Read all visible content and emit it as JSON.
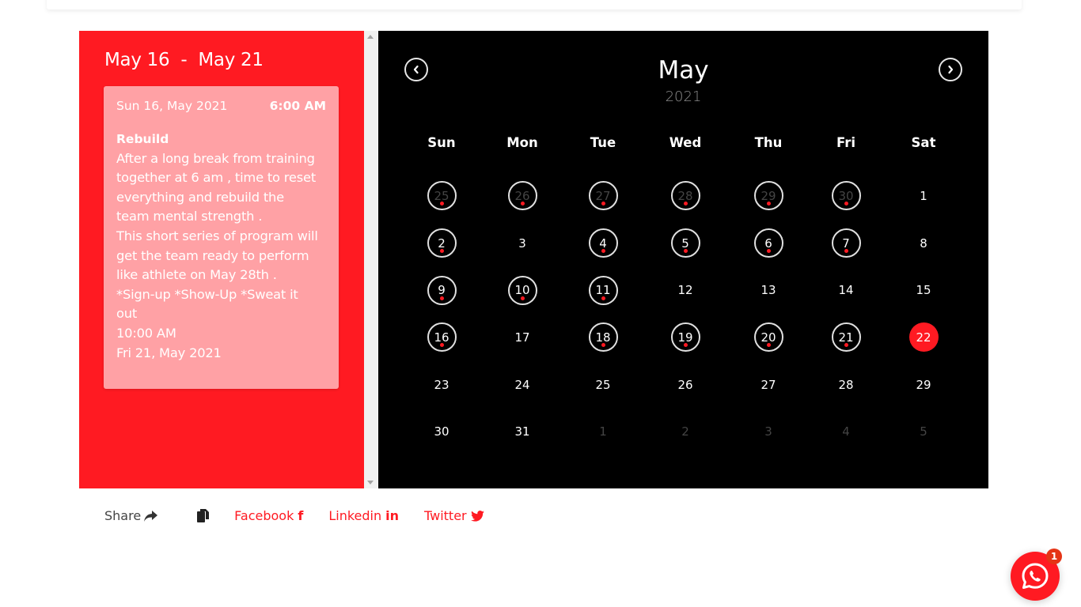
{
  "event_panel": {
    "range_title": "May 16  -  May 21",
    "event": {
      "start_date": "Sun 16, May 2021",
      "start_time": "6:00 AM",
      "title": "Rebuild",
      "description_lines": [
        "After a long break from training",
        "together at 6 am , time to reset",
        "everything and rebuild the",
        "team mental strength .",
        "This short series of program will",
        "get the team ready to perform",
        "like athlete on May 28th .",
        "*Sign-up *Show-Up *Sweat it",
        "out"
      ],
      "end_time": "10:00 AM",
      "end_date": "Fri 21, May 2021"
    }
  },
  "calendar": {
    "month": "May",
    "year": "2021",
    "prev_icon": "chevron-left-icon",
    "next_icon": "chevron-right-icon",
    "weekdays": [
      "Sun",
      "Mon",
      "Tue",
      "Wed",
      "Thu",
      "Fri",
      "Sat"
    ],
    "accent_color": "#ff1a22",
    "weeks": [
      [
        {
          "d": "25",
          "muted": true,
          "event": true
        },
        {
          "d": "26",
          "muted": true,
          "event": true
        },
        {
          "d": "27",
          "muted": true,
          "event": true
        },
        {
          "d": "28",
          "muted": true,
          "event": true
        },
        {
          "d": "29",
          "muted": true,
          "event": true
        },
        {
          "d": "30",
          "muted": true,
          "event": true
        },
        {
          "d": "1"
        }
      ],
      [
        {
          "d": "2",
          "event": true
        },
        {
          "d": "3"
        },
        {
          "d": "4",
          "event": true
        },
        {
          "d": "5",
          "event": true
        },
        {
          "d": "6",
          "event": true
        },
        {
          "d": "7",
          "event": true
        },
        {
          "d": "8"
        }
      ],
      [
        {
          "d": "9",
          "event": true
        },
        {
          "d": "10",
          "event": true
        },
        {
          "d": "11",
          "event": true
        },
        {
          "d": "12"
        },
        {
          "d": "13"
        },
        {
          "d": "14"
        },
        {
          "d": "15"
        }
      ],
      [
        {
          "d": "16",
          "event": true
        },
        {
          "d": "17"
        },
        {
          "d": "18",
          "event": true
        },
        {
          "d": "19",
          "event": true
        },
        {
          "d": "20",
          "event": true
        },
        {
          "d": "21",
          "event": true
        },
        {
          "d": "22",
          "today": true
        }
      ],
      [
        {
          "d": "23"
        },
        {
          "d": "24"
        },
        {
          "d": "25"
        },
        {
          "d": "26"
        },
        {
          "d": "27"
        },
        {
          "d": "28"
        },
        {
          "d": "29"
        }
      ],
      [
        {
          "d": "30"
        },
        {
          "d": "31"
        },
        {
          "d": "1",
          "muted": true
        },
        {
          "d": "2",
          "muted": true
        },
        {
          "d": "3",
          "muted": true
        },
        {
          "d": "4",
          "muted": true
        },
        {
          "d": "5",
          "muted": true
        }
      ]
    ]
  },
  "share": {
    "label": "Share",
    "links": [
      {
        "label": "Facebook",
        "icon": "facebook-icon",
        "glyph": "f"
      },
      {
        "label": "Linkedin",
        "icon": "linkedin-icon",
        "glyph": "in"
      },
      {
        "label": "Twitter",
        "icon": "twitter-icon",
        "glyph": ""
      }
    ]
  },
  "whatsapp": {
    "badge_count": "1"
  }
}
